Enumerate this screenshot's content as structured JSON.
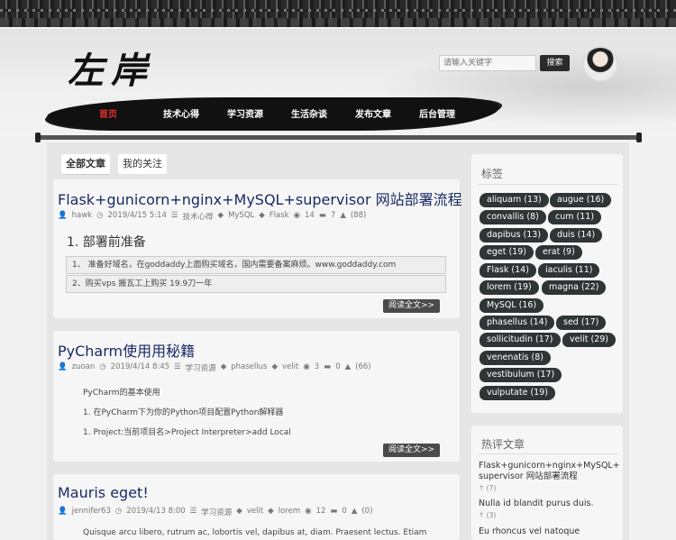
{
  "brand": {
    "logo_text": "左岸"
  },
  "search": {
    "placeholder": "请输入关键字",
    "button_label": "搜索"
  },
  "nav": [
    "首页",
    "技术心得",
    "学习资源",
    "生活杂谈",
    "发布文章",
    "后台管理"
  ],
  "tabs": [
    "全部文章",
    "我的关注"
  ],
  "posts": [
    {
      "title": "Flask+gunicorn+nginx+MySQL+supervisor 网站部署流程",
      "author": "hawk",
      "date": "2019/4/15 5:14",
      "category": "技术心得",
      "tags": [
        "MySQL",
        "Flask"
      ],
      "views": "14",
      "comments": "7",
      "likes": "(88)",
      "heading": "1. 部署前准备",
      "quotes": [
        "1、 准备好域名，在goddaddy上面购买域名，国内需要备案麻烦。www.goddaddy.com",
        "2、购买vps 搬瓦工上购买 19.9刀一年"
      ],
      "read_more": "阅读全文>>"
    },
    {
      "title": "PyCharm使用用秘籍",
      "author": "zuoan",
      "date": "2019/4/14 8:45",
      "category": "学习资源",
      "tags": [
        "phasellus",
        "velit"
      ],
      "views": "3",
      "comments": "0",
      "likes": "(66)",
      "paragraphs": [
        "PyCharm的基本使用",
        "1. 在PyCharm下为你的Python项目配置Python解释器",
        "1. Project:当前项目名>Project Interpreter>add Local"
      ],
      "read_more": "阅读全文>>"
    },
    {
      "title": "Mauris eget!",
      "author": "jennifer63",
      "date": "2019/4/13 8:00",
      "category": "学习资源",
      "tags": [
        "velit",
        "lorem"
      ],
      "views": "12",
      "comments": "0",
      "likes": "(0)",
      "paragraphs": [
        "Quisque arcu libero, rutrum ac, lobortis vel, dapibus at, diam. Praesent lectus. Etiam"
      ]
    }
  ],
  "sidebar": {
    "tags_title": "标签",
    "tags": [
      "aliquam (13)",
      "augue (16)",
      "convallis (8)",
      "cum (11)",
      "dapibus (13)",
      "duis (14)",
      "eget (19)",
      "erat (9)",
      "Flask (14)",
      "iaculis (11)",
      "lorem (19)",
      "magna (22)",
      "MySQL (16)",
      "phasellus (14)",
      "sed (17)",
      "sollicitudin (17)",
      "velit (29)",
      "venenatis (8)",
      "vestibulum (17)",
      "vulputate (19)"
    ],
    "hot_title": "热评文章",
    "hot": [
      {
        "title": "Flask+gunicorn+nginx+MySQL+supervisor 网站部署流程",
        "count": "(7)"
      },
      {
        "title": "Nulla id blandit purus duis.",
        "count": "(3)"
      },
      {
        "title": "Eu rhoncus vel natoque",
        "count": ""
      }
    ]
  },
  "icons": {
    "author": "user-icon",
    "date": "clock-icon",
    "category": "list-icon",
    "tag": "tag-icon",
    "views": "eye-icon",
    "comments": "comment-icon",
    "likes": "thumb-up-icon",
    "hot": "fire-icon"
  },
  "colors": {
    "nav_active": "#e2302b",
    "title": "#1b2a66",
    "tag_bg": "#2f3535"
  }
}
